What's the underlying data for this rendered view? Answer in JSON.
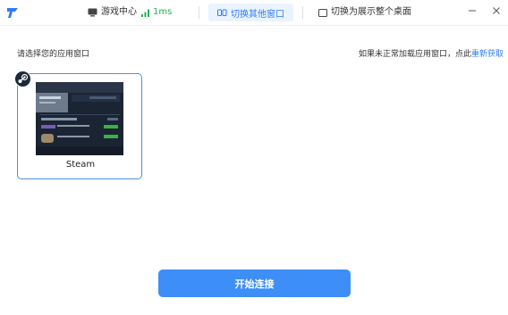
{
  "titlebar": {
    "logo_icon": "app-logo-icon",
    "game_center": "游戏中心",
    "ping": "1ms",
    "switch_window_tab": "切换其他窗口",
    "switch_desktop_tab": "切换为展示整个桌面",
    "minimize_icon": "minimize-icon",
    "close_icon": "close-icon"
  },
  "main": {
    "hint_left": "请选择您的应用窗口",
    "hint_right_prefix": "如果未正常加载应用窗口，点此",
    "refresh_link": "重新获取",
    "windows": [
      {
        "label": "Steam",
        "icon": "steam-icon"
      }
    ],
    "start_button": "开始连接"
  },
  "colors": {
    "accent": "#3d8ef7",
    "tab_active_bg": "#eaf3ff",
    "ping_green": "#22b14c"
  }
}
